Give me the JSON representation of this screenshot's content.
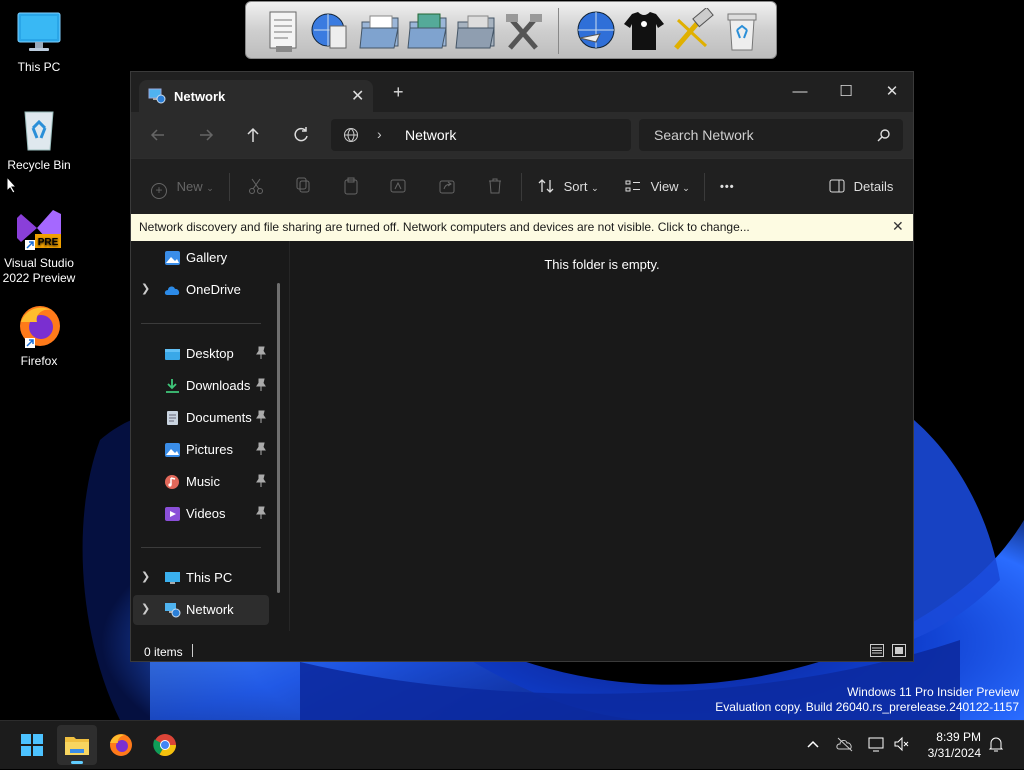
{
  "desktop": {
    "icons": [
      {
        "label": "This PC"
      },
      {
        "label": "Recycle Bin"
      },
      {
        "label": "Visual Studio\n2022 Preview",
        "line1": "Visual Studio",
        "line2": "2022 Preview",
        "badge": "PRE"
      },
      {
        "label": "Firefox"
      }
    ]
  },
  "dock": {
    "items": [
      "document-icon",
      "globe-document-icon",
      "folder-icon",
      "folder-green-icon",
      "folder-gray-icon",
      "tools-icon",
      "globe-arrow-icon",
      "tshirt-icon",
      "hammer-icon",
      "trash-icon"
    ]
  },
  "window": {
    "tab_label": "Network",
    "new_tab": "+",
    "controls": {
      "minimize": "—",
      "maximize": "☐",
      "close": "✕"
    },
    "address": {
      "crumb": "Network",
      "separator": "›"
    },
    "search_placeholder": "Search Network",
    "toolbar": {
      "new_label": "New",
      "sort_label": "Sort",
      "view_label": "View",
      "more_label": "•••",
      "details_label": "Details"
    },
    "infobar": {
      "message": "Network discovery and file sharing are turned off. Network computers and devices are not visible. Click to change...",
      "close": "✕"
    },
    "sidebar": {
      "gallery": "Gallery",
      "onedrive": "OneDrive",
      "quick": [
        {
          "label": "Desktop"
        },
        {
          "label": "Downloads"
        },
        {
          "label": "Documents"
        },
        {
          "label": "Pictures"
        },
        {
          "label": "Music"
        },
        {
          "label": "Videos"
        }
      ],
      "thispc": "This PC",
      "network": "Network"
    },
    "content": {
      "empty": "This folder is empty."
    },
    "status": {
      "count": "0 items"
    }
  },
  "watermark": {
    "line1": "Windows 11 Pro Insider Preview",
    "line2": "Evaluation copy. Build 26040.rs_prerelease.240122-1157"
  },
  "taskbar": {
    "time": "8:39 PM",
    "date": "3/31/2024"
  },
  "colors": {
    "accent": "#60cdff",
    "infobar": "#fdfbe2",
    "window_bg": "#191919"
  }
}
